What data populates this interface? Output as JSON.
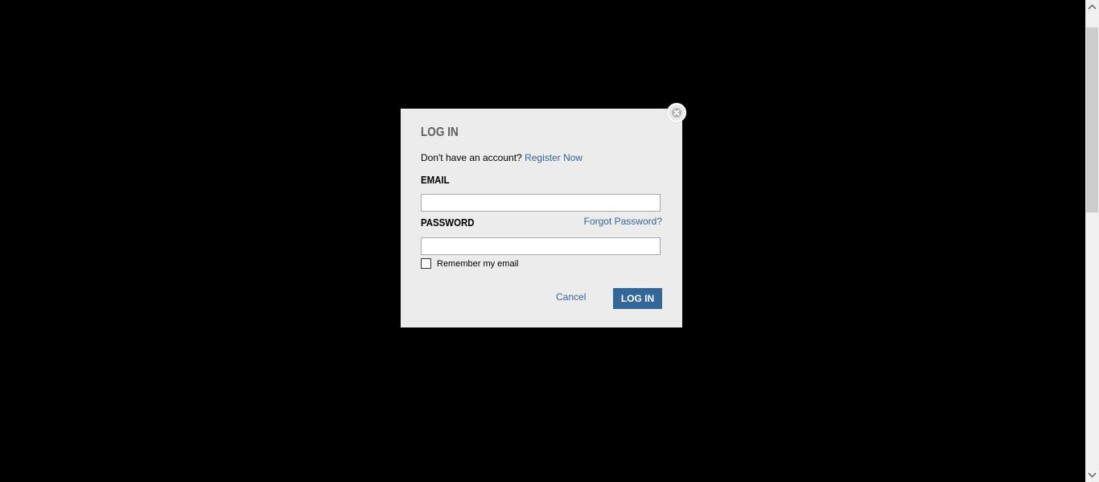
{
  "overlay": {
    "background_color": "#000000"
  },
  "login_modal": {
    "title": "LOG IN",
    "register_prompt": "Don't have an account?",
    "register_link": "Register Now",
    "email_label": "EMAIL",
    "email_value": "",
    "password_label": "PASSWORD",
    "password_value": "",
    "forgot_password_link": "Forgot Password?",
    "remember_label": "Remember my email",
    "remember_checked": false,
    "cancel_label": "Cancel",
    "login_button_label": "LOG IN",
    "close_icon": "close-icon"
  },
  "colors": {
    "accent": "#336699",
    "modal_background": "#ececec",
    "title_color": "#5f5f5f"
  },
  "icons": {
    "scroll_up": "chevron-up-icon",
    "scroll_down": "chevron-down-icon"
  }
}
